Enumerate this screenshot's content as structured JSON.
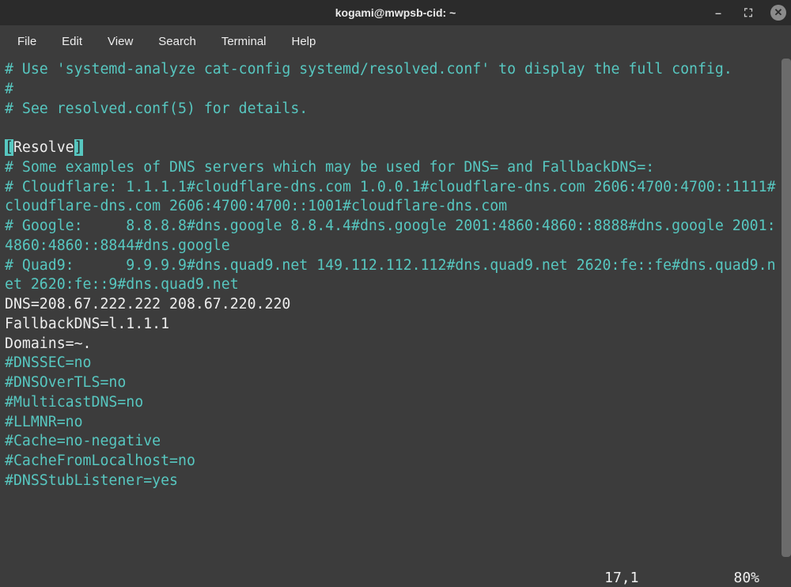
{
  "window": {
    "title": "kogami@mwpsb-cid: ~",
    "controls": {
      "minimize": "–",
      "maximize": "⛶",
      "close": "✕"
    }
  },
  "menu": {
    "file": "File",
    "edit": "Edit",
    "view": "View",
    "search": "Search",
    "terminal": "Terminal",
    "help": "Help"
  },
  "file": {
    "lines": [
      {
        "style": "comment",
        "text": "# Use 'systemd-analyze cat-config systemd/resolved.conf' to display the full config."
      },
      {
        "style": "comment",
        "text": "#"
      },
      {
        "style": "comment",
        "text": "# See resolved.conf(5) for details."
      },
      {
        "style": "plain",
        "text": ""
      },
      {
        "style": "section",
        "text": "[Resolve]"
      },
      {
        "style": "comment",
        "text": "# Some examples of DNS servers which may be used for DNS= and FallbackDNS=:"
      },
      {
        "style": "comment",
        "text": "# Cloudflare: 1.1.1.1#cloudflare-dns.com 1.0.0.1#cloudflare-dns.com 2606:4700:4700::1111#cloudflare-dns.com 2606:4700:4700::1001#cloudflare-dns.com"
      },
      {
        "style": "comment",
        "text": "# Google:     8.8.8.8#dns.google 8.8.4.4#dns.google 2001:4860:4860::8888#dns.google 2001:4860:4860::8844#dns.google"
      },
      {
        "style": "comment",
        "text": "# Quad9:      9.9.9.9#dns.quad9.net 149.112.112.112#dns.quad9.net 2620:fe::fe#dns.quad9.net 2620:fe::9#dns.quad9.net"
      },
      {
        "style": "plain",
        "text": "DNS=208.67.222.222 208.67.220.220"
      },
      {
        "style": "plain",
        "text": "FallbackDNS=l.1.1.1"
      },
      {
        "style": "plain",
        "text": "Domains=~."
      },
      {
        "style": "comment",
        "text": "#DNSSEC=no"
      },
      {
        "style": "comment",
        "text": "#DNSOverTLS=no"
      },
      {
        "style": "comment",
        "text": "#MulticastDNS=no"
      },
      {
        "style": "comment",
        "text": "#LLMNR=no"
      },
      {
        "style": "comment",
        "text": "#Cache=no-negative"
      },
      {
        "style": "comment",
        "text": "#CacheFromLocalhost=no"
      },
      {
        "style": "comment",
        "text": "#DNSStubListener=yes"
      }
    ]
  },
  "status": {
    "position": "17,1",
    "percent": "80%"
  }
}
